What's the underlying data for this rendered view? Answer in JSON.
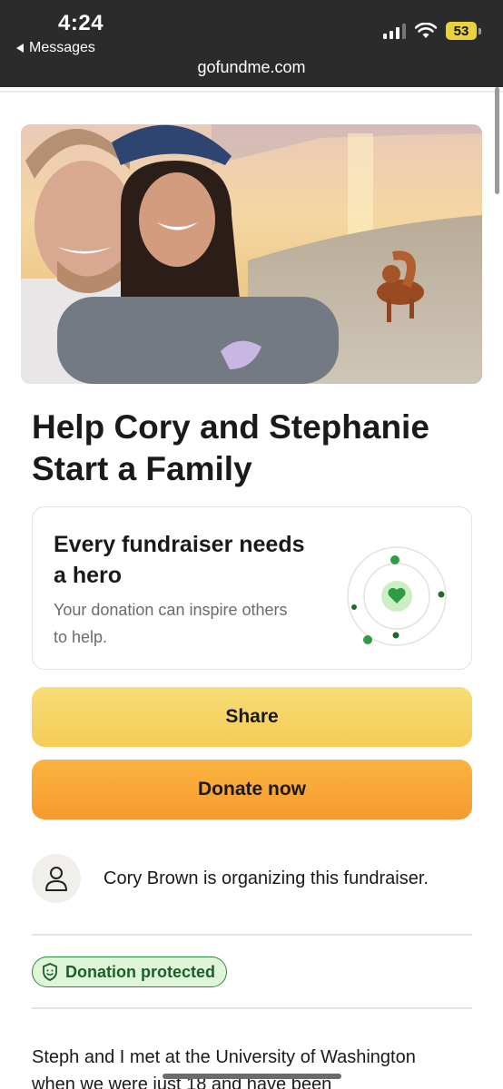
{
  "status_bar": {
    "time": "4:24",
    "back_app": "Messages",
    "battery": "53"
  },
  "browser": {
    "url": "gofundme.com"
  },
  "fundraiser": {
    "title_line1": "Help Cory and Stephanie",
    "title_line2": "Start a Family"
  },
  "hero_card": {
    "title_line1": "Every fundraiser needs",
    "title_line2": "a hero",
    "body_line1": "Your donation can inspire others",
    "body_line2": "to help."
  },
  "actions": {
    "share_label": "Share",
    "donate_label": "Donate now"
  },
  "organizer": {
    "text": "Cory Brown is organizing this fundraiser."
  },
  "badge": {
    "label": "Donation protected"
  },
  "story": {
    "line1": "Steph and I met at the University of Washington",
    "line2": "when we were just 18 and have been"
  },
  "colors": {
    "share_bg": "#f6d25e",
    "donate_bg": "#f8a736",
    "badge_green": "#2a8a3a",
    "heart_green": "#2e9b45"
  },
  "icons": [
    "back-triangle-icon",
    "signal-icon",
    "wifi-icon",
    "battery-icon",
    "heart-icon",
    "person-icon",
    "shield-smile-icon"
  ]
}
